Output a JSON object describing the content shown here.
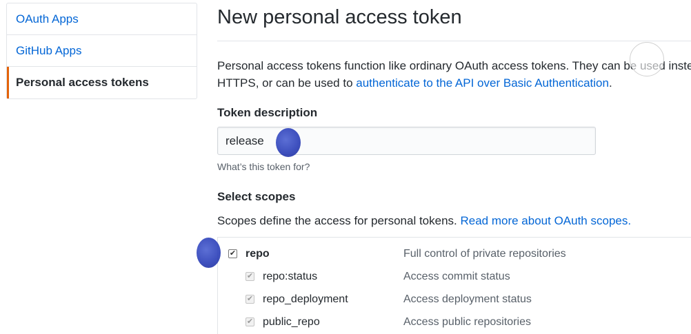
{
  "sidebar": {
    "items": [
      {
        "label": "OAuth Apps"
      },
      {
        "label": "GitHub Apps"
      },
      {
        "label": "Personal access tokens"
      }
    ]
  },
  "main": {
    "title": "New personal access token",
    "intro_line1": "Personal access tokens function like ordinary OAuth access tokens. They can be used inste",
    "intro_line2_prefix": "HTTPS, or can be used to ",
    "intro_link": "authenticate to the API over Basic Authentication",
    "intro_line2_suffix": ".",
    "token_description_label": "Token description",
    "token_input_value": "release",
    "token_note": "What’s this token for?",
    "select_scopes_label": "Select scopes",
    "scopes_intro_prefix": "Scopes define the access for personal tokens. ",
    "scopes_intro_link": "Read more about OAuth scopes.",
    "scopes": [
      {
        "name": "repo",
        "description": "Full control of private repositories",
        "checked": true,
        "parent": true
      },
      {
        "name": "repo:status",
        "description": "Access commit status",
        "checked": true,
        "parent": false
      },
      {
        "name": "repo_deployment",
        "description": "Access deployment status",
        "checked": true,
        "parent": false
      },
      {
        "name": "public_repo",
        "description": "Access public repositories",
        "checked": true,
        "parent": false
      }
    ]
  },
  "colors": {
    "link": "#0366d6",
    "selected_accent": "#e36209"
  }
}
